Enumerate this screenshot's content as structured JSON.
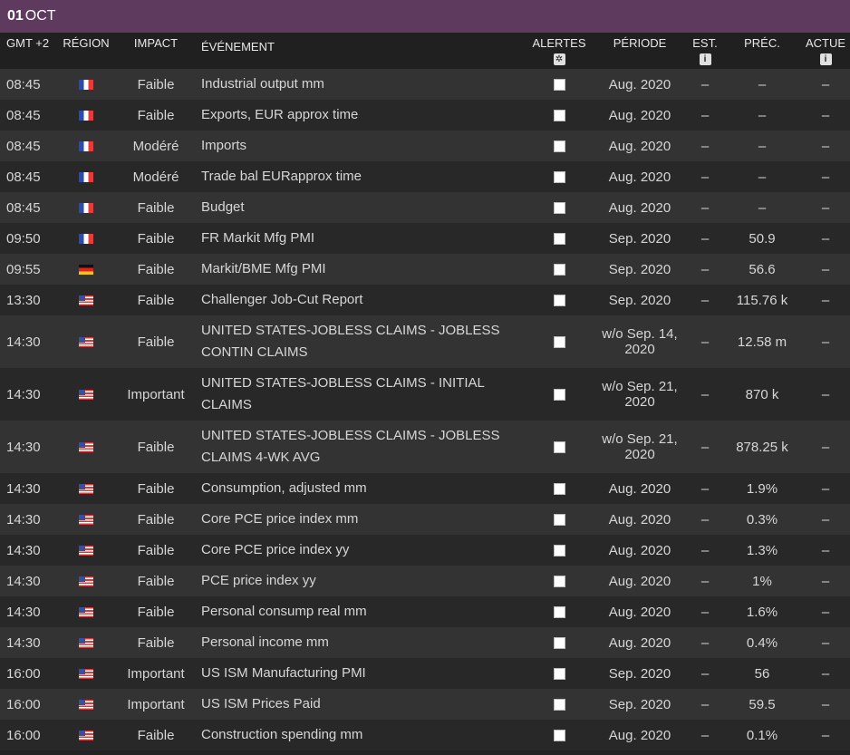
{
  "date": {
    "day": "01",
    "month": "OCT"
  },
  "columns": {
    "time": "GMT +2",
    "region": "RÉGION",
    "impact": "IMPACT",
    "event": "ÉVÉNEMENT",
    "alerts": "ALERTES",
    "period": "PÉRIODE",
    "est": "EST.",
    "prec": "PRÉC.",
    "actual": "ACTUE"
  },
  "icons": {
    "gear": "gear-icon",
    "info": "info-icon"
  },
  "colors": {
    "date_bar": "#5f3a5f",
    "row_odd": "#333333",
    "row_even": "#282828"
  },
  "rows": [
    {
      "time": "08:45",
      "flag": "fr",
      "impact": "Faible",
      "event": "Industrial output mm",
      "period": "Aug. 2020",
      "est": "–",
      "prec": "–",
      "actual": "–"
    },
    {
      "time": "08:45",
      "flag": "fr",
      "impact": "Faible",
      "event": "Exports, EUR approx time",
      "period": "Aug. 2020",
      "est": "–",
      "prec": "–",
      "actual": "–"
    },
    {
      "time": "08:45",
      "flag": "fr",
      "impact": "Modéré",
      "event": "Imports",
      "period": "Aug. 2020",
      "est": "–",
      "prec": "–",
      "actual": "–"
    },
    {
      "time": "08:45",
      "flag": "fr",
      "impact": "Modéré",
      "event": "Trade bal EURapprox time",
      "period": "Aug. 2020",
      "est": "–",
      "prec": "–",
      "actual": "–"
    },
    {
      "time": "08:45",
      "flag": "fr",
      "impact": "Faible",
      "event": "Budget",
      "period": "Aug. 2020",
      "est": "–",
      "prec": "–",
      "actual": "–"
    },
    {
      "time": "09:50",
      "flag": "fr",
      "impact": "Faible",
      "event": "FR Markit Mfg PMI",
      "period": "Sep. 2020",
      "est": "–",
      "prec": "50.9",
      "actual": "–"
    },
    {
      "time": "09:55",
      "flag": "de",
      "impact": "Faible",
      "event": "Markit/BME Mfg PMI",
      "period": "Sep. 2020",
      "est": "–",
      "prec": "56.6",
      "actual": "–"
    },
    {
      "time": "13:30",
      "flag": "us",
      "impact": "Faible",
      "event": "Challenger Job-Cut Report",
      "period": "Sep. 2020",
      "est": "–",
      "prec": "115.76 k",
      "actual": "–"
    },
    {
      "time": "14:30",
      "flag": "us",
      "impact": "Faible",
      "event": "UNITED STATES-JOBLESS CLAIMS - JOBLESS CONTIN CLAIMS",
      "period": "w/o Sep. 14, 2020",
      "est": "–",
      "prec": "12.58 m",
      "actual": "–",
      "tall": true
    },
    {
      "time": "14:30",
      "flag": "us",
      "impact": "Important",
      "event": "UNITED STATES-JOBLESS CLAIMS - INITIAL CLAIMS",
      "period": "w/o Sep. 21, 2020",
      "est": "–",
      "prec": "870 k",
      "actual": "–",
      "tall": true
    },
    {
      "time": "14:30",
      "flag": "us",
      "impact": "Faible",
      "event": "UNITED STATES-JOBLESS CLAIMS - JOBLESS CLAIMS 4-WK AVG",
      "period": "w/o Sep. 21, 2020",
      "est": "–",
      "prec": "878.25 k",
      "actual": "–",
      "tall": true
    },
    {
      "time": "14:30",
      "flag": "us",
      "impact": "Faible",
      "event": "Consumption, adjusted mm",
      "period": "Aug. 2020",
      "est": "–",
      "prec": "1.9%",
      "actual": "–"
    },
    {
      "time": "14:30",
      "flag": "us",
      "impact": "Faible",
      "event": "Core PCE price index mm",
      "period": "Aug. 2020",
      "est": "–",
      "prec": "0.3%",
      "actual": "–"
    },
    {
      "time": "14:30",
      "flag": "us",
      "impact": "Faible",
      "event": "Core PCE price index yy",
      "period": "Aug. 2020",
      "est": "–",
      "prec": "1.3%",
      "actual": "–"
    },
    {
      "time": "14:30",
      "flag": "us",
      "impact": "Faible",
      "event": "PCE price index yy",
      "period": "Aug. 2020",
      "est": "–",
      "prec": "1%",
      "actual": "–"
    },
    {
      "time": "14:30",
      "flag": "us",
      "impact": "Faible",
      "event": "Personal consump real mm",
      "period": "Aug. 2020",
      "est": "–",
      "prec": "1.6%",
      "actual": "–"
    },
    {
      "time": "14:30",
      "flag": "us",
      "impact": "Faible",
      "event": "Personal income mm",
      "period": "Aug. 2020",
      "est": "–",
      "prec": "0.4%",
      "actual": "–"
    },
    {
      "time": "16:00",
      "flag": "us",
      "impact": "Important",
      "event": "US ISM Manufacturing PMI",
      "period": "Sep. 2020",
      "est": "–",
      "prec": "56",
      "actual": "–"
    },
    {
      "time": "16:00",
      "flag": "us",
      "impact": "Important",
      "event": "US ISM Prices Paid",
      "period": "Sep. 2020",
      "est": "–",
      "prec": "59.5",
      "actual": "–"
    },
    {
      "time": "16:00",
      "flag": "us",
      "impact": "Faible",
      "event": "Construction spending mm",
      "period": "Aug. 2020",
      "est": "–",
      "prec": "0.1%",
      "actual": "–"
    }
  ]
}
